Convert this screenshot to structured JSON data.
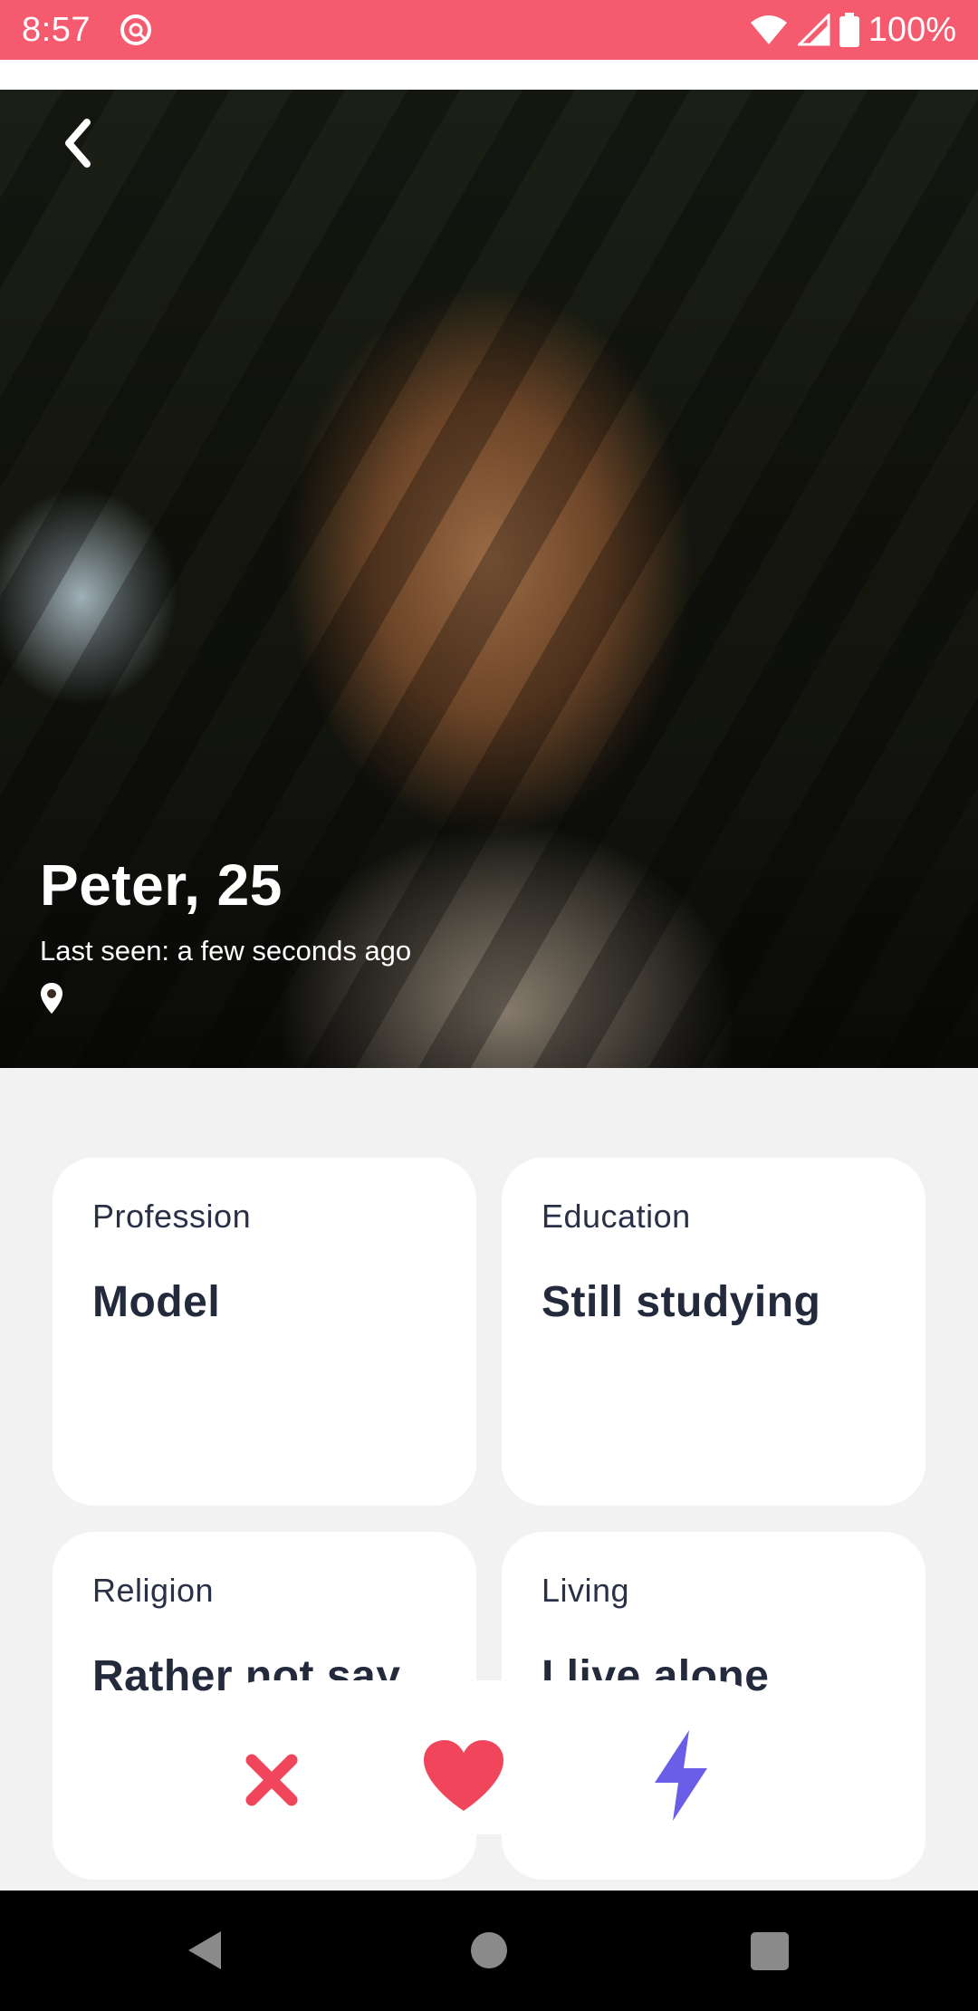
{
  "status_bar": {
    "time": "8:57",
    "battery": "100%",
    "icons": [
      "notification-app-icon",
      "wifi-icon",
      "signal-icon",
      "battery-icon"
    ],
    "background": "#f65a6e"
  },
  "profile": {
    "name_age": "Peter, 25",
    "last_seen": "Last seen: a few seconds ago"
  },
  "cards": [
    {
      "label": "Profession",
      "value": "Model"
    },
    {
      "label": "Education",
      "value": "Still studying"
    },
    {
      "label": "Religion",
      "value": "Rather not say"
    },
    {
      "label": "Living",
      "value": "I live alone"
    }
  ],
  "actions": {
    "dislike_color": "#f0455a",
    "like_color": "#f0455a",
    "boost_color": "#6a5ee8"
  },
  "icons": [
    "back-chevron-icon",
    "location-pin-icon",
    "close-x-icon",
    "heart-icon",
    "lightning-icon",
    "nav-back-icon",
    "nav-home-icon",
    "nav-recents-icon"
  ]
}
